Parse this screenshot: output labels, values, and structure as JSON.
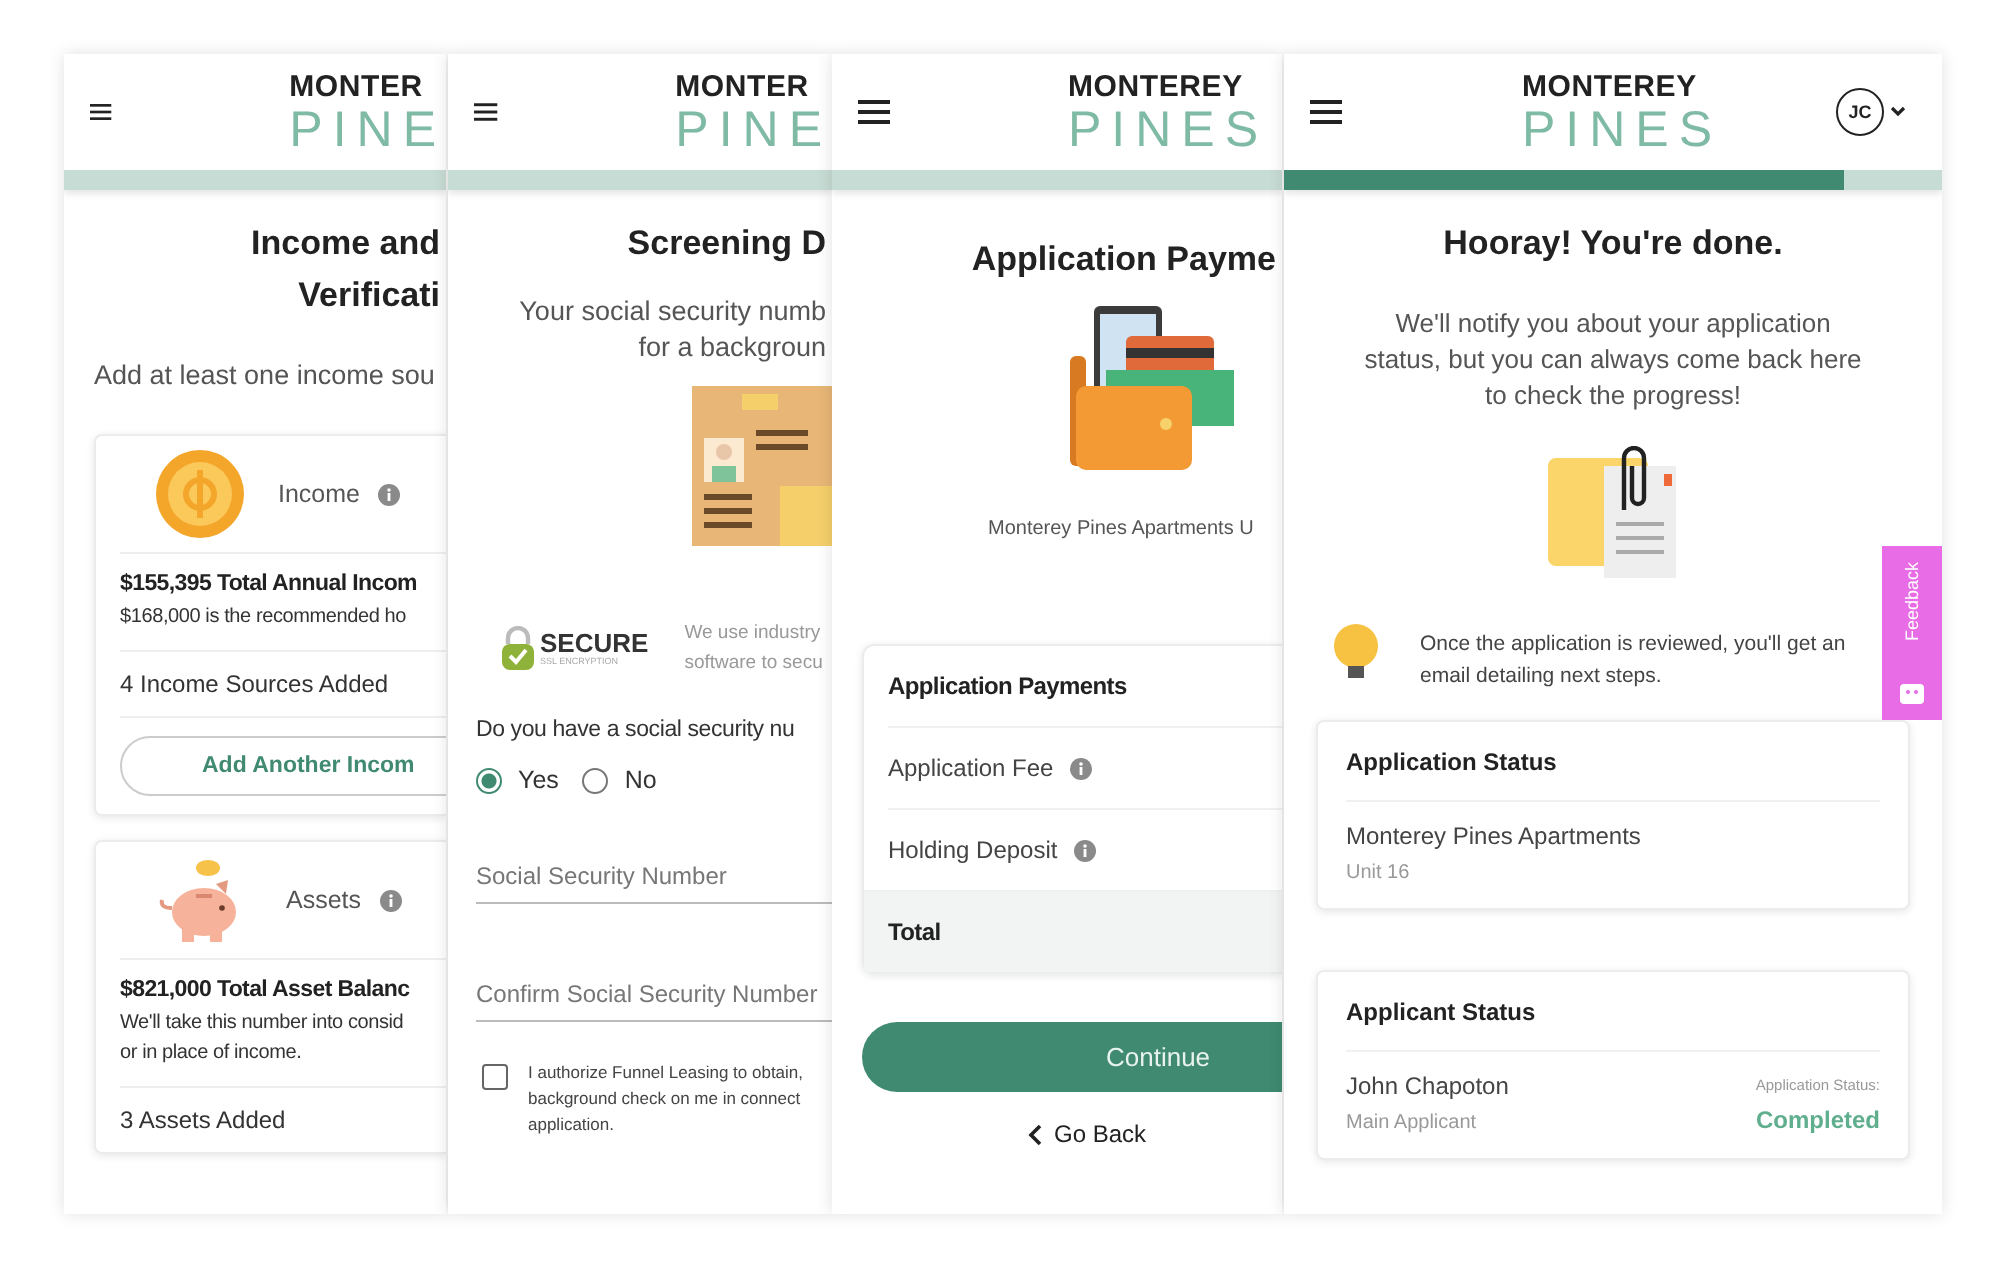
{
  "screens": [
    {
      "kind": "income",
      "logo": {
        "top": "MONTER",
        "bottom": "PINE"
      },
      "title": [
        "Income and",
        "Verificati"
      ],
      "subtitle": "Add at least one income sou",
      "income": {
        "label": "Income",
        "total": "$155,395 Total Annual Incom",
        "note": "$168,000 is the recommended ho",
        "count": "4 Income Sources Added",
        "button": "Add Another Incom"
      },
      "assets": {
        "label": "Assets",
        "total": "$821,000 Total Asset Balanc",
        "note": [
          "We'll take this number into consid",
          "or in place of income."
        ],
        "count": "3 Assets Added"
      }
    },
    {
      "kind": "screening",
      "logo": {
        "top": "MONTER",
        "bottom": "PINE"
      },
      "title": [
        "Screening D"
      ],
      "intro": [
        "Your social security numb",
        "for a backgroun"
      ],
      "secure": {
        "badge": "SECURE",
        "badge_sub": "SSL ENCRYPTION",
        "text": [
          "We use industry",
          "software to secu"
        ]
      },
      "question": "Do you have a social security nu",
      "radios": [
        {
          "label": "Yes",
          "selected": true
        },
        {
          "label": "No",
          "selected": false
        }
      ],
      "fields": [
        {
          "placeholder": "Social Security Number"
        },
        {
          "placeholder": "Confirm Social Security Number"
        }
      ],
      "consent": {
        "checked": false,
        "lines": [
          "I authorize Funnel Leasing to obtain,",
          "background check on me in connect",
          "application."
        ]
      }
    },
    {
      "kind": "payment",
      "logo": {
        "top": "MONTEREY",
        "bottom": "PINES"
      },
      "title": [
        "Application Payme"
      ],
      "property": "Monterey Pines Apartments U",
      "table": {
        "heading": "Application Payments",
        "rows": [
          "Application Fee",
          "Holding Deposit"
        ],
        "total": "Total"
      },
      "button": "Continue",
      "back": "Go Back"
    },
    {
      "kind": "done",
      "logo": {
        "top": "MONTEREY",
        "bottom": "PINES"
      },
      "avatar": "JC",
      "progress": {
        "level": 0.85
      },
      "title": [
        "Hooray! You're done."
      ],
      "message": "We'll notify you about your application status, but you can always come back here to check the progress!",
      "tip": "Once the application is reviewed, you'll get an email detailing next steps.",
      "application_status": {
        "heading": "Application Status",
        "property": "Monterey Pines Apartments",
        "unit": "Unit 16"
      },
      "applicant_status": {
        "heading": "Applicant Status",
        "name": "John Chapoton",
        "role": "Main Applicant",
        "status_label": "Application Status:",
        "status": "Completed"
      },
      "feedback": "Feedback"
    }
  ]
}
